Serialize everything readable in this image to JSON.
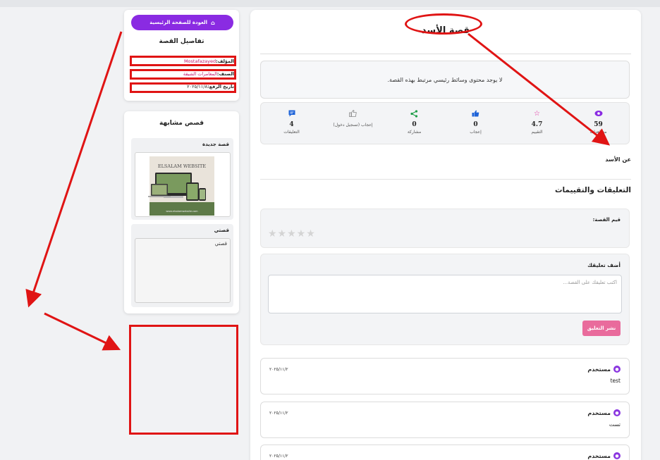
{
  "story": {
    "title": "قصة الأسد",
    "media_message": "لا يوجد محتوى وسائط رئيسي مرتبط بهذه القصة.",
    "about": "عن الأسد"
  },
  "stats": [
    {
      "icon": "eye-icon",
      "color": "#8a2be2",
      "value": "59",
      "label": "مشاهدات"
    },
    {
      "icon": "star-icon",
      "color": "#e0249b",
      "value": "4.7",
      "label": "التقييم"
    },
    {
      "icon": "thumbs-up-icon",
      "color": "#1e63d8",
      "value": "0",
      "label": "إعجاب"
    },
    {
      "icon": "share-icon",
      "color": "#1f9e48",
      "value": "0",
      "label": "مشاركة"
    },
    {
      "icon": "thumbs-up-outline-icon",
      "color": "#888888",
      "value": "",
      "label": "إعجاب (تسجيل دخول)"
    },
    {
      "icon": "comment-icon",
      "color": "#1e63d8",
      "value": "4",
      "label": "التعليقات"
    }
  ],
  "comments_section": {
    "heading": "التعليقات والتقييمات",
    "rate_label": "قيم القصة:",
    "stars": "★★★★★",
    "add_label": "أضف تعليقك",
    "placeholder": "اكتب تعليقك على القصة...",
    "post_button": "نشر التعليق"
  },
  "comments": [
    {
      "user": "مستخدم",
      "date": "٢٠٢٥/١١/٢",
      "text": "test"
    },
    {
      "user": "مستخدم",
      "date": "٢٠٢٥/١١/٢",
      "text": "تست"
    },
    {
      "user": "مستخدم",
      "date": "٢٠٢٥/١١/٢",
      "text": ""
    }
  ],
  "sidebar": {
    "home_button": "العودة للصفحة الرئيسية",
    "details_heading": "تفاصيل القصة",
    "author_label": "المؤلف:",
    "author_value": "Mostafazayed",
    "category_label": "الصنف:",
    "category_value": "المغامرات الشيقة",
    "date_label": "تاريخ الرفع:",
    "date_value": "٢٠٢٥/١١/٨",
    "similar_heading": "قصص مشابهة",
    "similar": [
      {
        "title": "قصة جديدة",
        "image_caption": "ELSALAM WEBSITE",
        "image_footer": "www.elsalamwebsite.com"
      },
      {
        "title": "قصتي",
        "alt": "قصتي"
      }
    ]
  },
  "colors": {
    "accent": "#8a2be2",
    "pink": "#e96b9c",
    "annotation": "#e01414"
  }
}
